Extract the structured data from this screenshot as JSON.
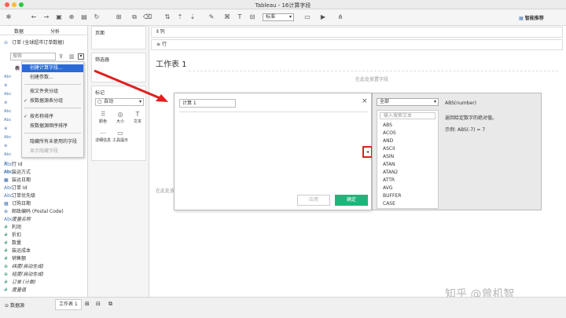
{
  "window": {
    "title": "Tableau - 16计算字段"
  },
  "toolbar": {
    "format_select": "标准",
    "show_me_label": "智能推荐"
  },
  "left_pane": {
    "tab_data": "数据",
    "tab_analysis": "分析",
    "datasource": "订单 (全球超市订单数据)",
    "search_placeholder": "搜索",
    "section_table": "表",
    "fields": [
      {
        "icon": "Abc",
        "label": "行 Id",
        "kind": "dim"
      },
      {
        "icon": "Abc",
        "label": "装运方式",
        "kind": "dim"
      },
      {
        "icon": "date",
        "label": "装运日期",
        "kind": "dim"
      },
      {
        "icon": "Abc",
        "label": "订单 Id",
        "kind": "dim"
      },
      {
        "icon": "Abc",
        "label": "订单优先级",
        "kind": "dim"
      },
      {
        "icon": "date",
        "label": "订购日期",
        "kind": "dim"
      },
      {
        "icon": "geo",
        "label": "邮政编码 (Postal Code)",
        "kind": "dim"
      },
      {
        "icon": "Abc",
        "label": "度量名称",
        "kind": "dim-italic"
      },
      {
        "icon": "#",
        "label": "利润",
        "kind": "meas"
      },
      {
        "icon": "#",
        "label": "折扣",
        "kind": "meas"
      },
      {
        "icon": "#",
        "label": "数量",
        "kind": "meas"
      },
      {
        "icon": "#",
        "label": "装运成本",
        "kind": "meas"
      },
      {
        "icon": "#",
        "label": "销售额",
        "kind": "meas"
      },
      {
        "icon": "geo",
        "label": "纬度(自动生成)",
        "kind": "meas-italic"
      },
      {
        "icon": "geo",
        "label": "经度(自动生成)",
        "kind": "meas-italic"
      },
      {
        "icon": "#",
        "label": "订单 (计数)",
        "kind": "meas-italic"
      },
      {
        "icon": "#",
        "label": "度量值",
        "kind": "meas-italic"
      }
    ]
  },
  "context_menu": {
    "items": [
      {
        "label": "创建计算字段...",
        "state": "highlight",
        "check": ""
      },
      {
        "label": "创建参数...",
        "state": "normal",
        "check": ""
      },
      {
        "label": "按文件夹分组",
        "state": "normal",
        "check": ""
      },
      {
        "label": "按数据源表分组",
        "state": "normal",
        "check": "✓"
      },
      {
        "label": "按名称排序",
        "state": "normal",
        "check": "✓"
      },
      {
        "label": "按数据源顺序排序",
        "state": "normal",
        "check": ""
      },
      {
        "label": "隐藏所有未使用的字段",
        "state": "normal",
        "check": ""
      },
      {
        "label": "显示隐藏字段",
        "state": "disabled",
        "check": ""
      }
    ]
  },
  "mid_pane": {
    "pages": "页面",
    "filters": "筛选器",
    "marks": "标记",
    "marks_type": "自动",
    "mark_buttons": [
      "颜色",
      "大小",
      "文本",
      "详细信息",
      "工具提示"
    ]
  },
  "shelves": {
    "columns": "列",
    "rows": "行"
  },
  "sheet": {
    "title": "工作表 1",
    "drop_top": "在此处放置字段",
    "drop_left": "在此处放"
  },
  "calc_dialog": {
    "name_value": "计算 1",
    "apply": "应用",
    "ok": "确定",
    "toggle": "◂"
  },
  "function_panel": {
    "category": "全部",
    "search_placeholder": "输入搜索文本",
    "functions": [
      "ABS",
      "ACOS",
      "AND",
      "ASCII",
      "ASIN",
      "ATAN",
      "ATAN2",
      "ATTR",
      "AVG",
      "BUFFER",
      "CASE"
    ],
    "signature": "ABS(number)",
    "description": "返回给定数字的绝对值。",
    "example": "示例: ABS(-7) = 7"
  },
  "status_bar": {
    "datasource_tab": "数据源",
    "sheet_tab": "工作表 1"
  },
  "watermark": "知乎 @曾机智",
  "colors": {
    "accent": "#2a6bd6",
    "ok_button": "#1fb57a",
    "annotation": "#e0201f"
  }
}
